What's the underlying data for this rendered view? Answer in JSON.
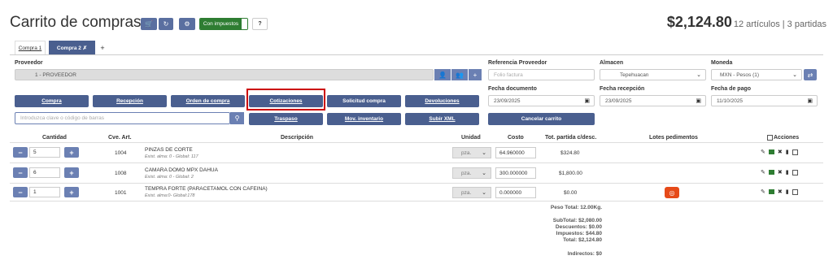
{
  "header": {
    "title": "Carrito de compras",
    "tool_icons": [
      "cart-icon",
      "refresh-icon",
      "gear-icon"
    ],
    "tax_toggle": "Con impuestos",
    "help": "?",
    "total_amount": "$2,124.80",
    "total_sub": "12 artículos | 3 partidas"
  },
  "tabs": [
    {
      "label": "Compra 1"
    },
    {
      "label": "Compra 2 ✗"
    },
    {
      "label": "+"
    }
  ],
  "supplier": {
    "label": "Proveedor",
    "value": "1 - PROVEEDOR"
  },
  "ref": {
    "label": "Referencia Proveedor",
    "placeholder": "Folio factura"
  },
  "warehouse": {
    "label": "Almacen",
    "value": "Tepehuacan"
  },
  "currency": {
    "label": "Moneda",
    "value": "MXN - Pesos (1)"
  },
  "doc_date": {
    "label": "Fecha documento",
    "value": "23/09/2025"
  },
  "rec_date": {
    "label": "Fecha recepción",
    "value": "23/09/2025"
  },
  "pay_date": {
    "label": "Fecha de pago",
    "value": "11/10/2025"
  },
  "actions": {
    "compra": "Compra",
    "recepcion": "Recepción",
    "orden": "Orden de compra",
    "cotizaciones": "Cotizaciones",
    "solicitud": "Solicitud compra",
    "devoluciones": "Devoluciones",
    "traspaso": "Traspaso",
    "mov_inv": "Mov. inventario",
    "subir_xml": "Subir XML",
    "cancelar": "Cancelar carrito"
  },
  "search": {
    "placeholder": "Introduzca clave o código de barras"
  },
  "table": {
    "headers": {
      "cantidad": "Cantidad",
      "cve": "Cve. Art.",
      "desc": "Descripción",
      "unidad": "Unidad",
      "costo": "Costo",
      "total": "Tot. partida c/desc.",
      "lotes": "Lotes pedimentos",
      "acciones": "Acciones"
    },
    "rows": [
      {
        "qty": "5",
        "cve": "1004",
        "name": "PINZAS DE CORTE",
        "sub": "Exist. alma: 0 - Global: 117",
        "unit": "pza.",
        "cost": "64.960000",
        "total": "$324.80"
      },
      {
        "qty": "6",
        "cve": "1008",
        "name": "CAMARA DOMO MPX DAHUA",
        "sub": "Exist. alma: 0 - Global: 2",
        "unit": "pza.",
        "cost": "300.000000",
        "total": "$1,800.00"
      },
      {
        "qty": "1",
        "cve": "1001",
        "name": "TEMPRA FORTE (PARACETAMOL CON CAFEINA)",
        "sub": "Exist. alma:0- Global:178",
        "unit": "pza.",
        "cost": "0.000000",
        "total": "$0.00"
      }
    ]
  },
  "summary": {
    "peso": "Peso Total:  12.00Kg.",
    "subtotal": "SubTotal: $2,080.00",
    "descuentos": "Descuentos:        $0.00",
    "impuestos": "Impuestos:      $44.80",
    "total": "Total: $2,124.80",
    "indirectos": "Indirectos:          $0"
  }
}
